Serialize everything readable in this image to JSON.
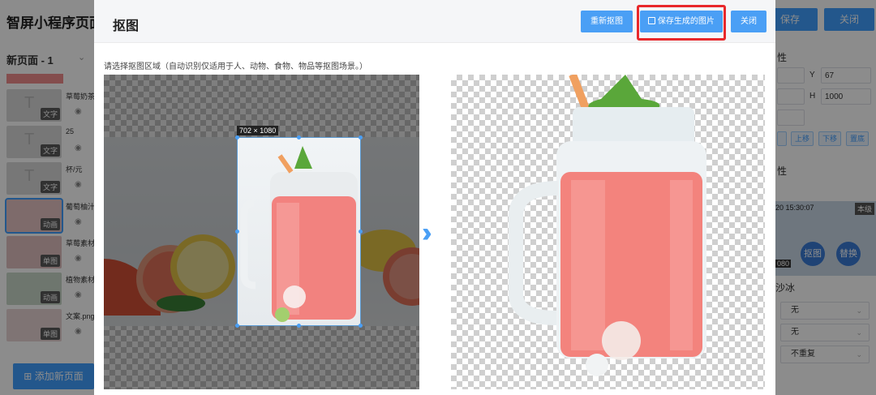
{
  "app": {
    "title": "智屏小程序页面设",
    "save_label": "保存",
    "close_label": "关闭",
    "page_selector": "新页面 - 1",
    "add_page_label": "添加新页面",
    "layers": [
      {
        "name": "草莓奶茶 — sw",
        "tag": "文字"
      },
      {
        "name": "25",
        "tag": "文字"
      },
      {
        "name": "杯/元",
        "tag": "文字"
      },
      {
        "name": "葡萄柚汁",
        "tag": "动画"
      },
      {
        "name": "草莓素材",
        "tag": "单图"
      },
      {
        "name": "植物素材",
        "tag": "动画"
      },
      {
        "name": "文案.png",
        "tag": "单图"
      }
    ]
  },
  "right_panel": {
    "section1": "性",
    "y_label": "Y",
    "y_value": "67",
    "h_label": "H",
    "h_value": "1000",
    "btn_up": "上移",
    "btn_down": "下移",
    "btn_replace": "置底",
    "section2": "性",
    "image_time": "20 15:30:07",
    "image_badge": "本级",
    "image_size": "080",
    "cutout_label": "抠图",
    "replace_label": "替换",
    "name_suffix": "沙冰",
    "select1": "无",
    "select2": "无",
    "select3": "不重复"
  },
  "dialog": {
    "title": "抠图",
    "btn_recut": "重新抠图",
    "btn_save": "保存生成的图片",
    "btn_close": "关闭",
    "hint": "请选择抠图区域（自动识别仅适用于人、动物、食物、物品等抠图场景。）",
    "crop_size": "702 × 1080",
    "save_icon": "floppy-icon",
    "arrow_icon": "double-chevron-right-icon"
  },
  "colors": {
    "accent": "#409eff",
    "highlight": "#e8282b"
  }
}
